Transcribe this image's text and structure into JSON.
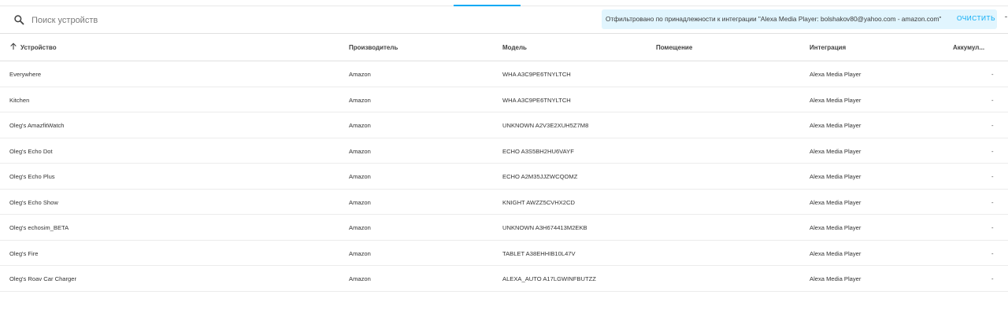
{
  "search": {
    "placeholder": "Поиск устройств"
  },
  "filter": {
    "text": "Отфильтровано по принадлежности к интеграции \"Alexa Media Player: bolshakov80@yahoo.com - amazon.com\"",
    "clear_label": "ОЧИСТИТЬ"
  },
  "columns": {
    "device": "Устройство",
    "manufacturer": "Производитель",
    "model": "Модель",
    "room": "Помещение",
    "integration": "Интеграция",
    "battery": "Аккумул..."
  },
  "rows": [
    {
      "device": "Everywhere",
      "manufacturer": "Amazon",
      "model": "WHA A3C9PE6TNYLTCH",
      "room": "",
      "integration": "Alexa Media Player",
      "battery": "-"
    },
    {
      "device": "Kitchen",
      "manufacturer": "Amazon",
      "model": "WHA A3C9PE6TNYLTCH",
      "room": "",
      "integration": "Alexa Media Player",
      "battery": "-"
    },
    {
      "device": "Oleg's AmazfitWatch",
      "manufacturer": "Amazon",
      "model": "UNKNOWN A2V3E2XUH5Z7M8",
      "room": "",
      "integration": "Alexa Media Player",
      "battery": "-"
    },
    {
      "device": "Oleg's Echo Dot",
      "manufacturer": "Amazon",
      "model": "ECHO A3S5BH2HU6VAYF",
      "room": "",
      "integration": "Alexa Media Player",
      "battery": "-"
    },
    {
      "device": "Oleg's Echo Plus",
      "manufacturer": "Amazon",
      "model": "ECHO A2M35JJZWCQOMZ",
      "room": "",
      "integration": "Alexa Media Player",
      "battery": "-"
    },
    {
      "device": "Oleg's Echo Show",
      "manufacturer": "Amazon",
      "model": "KNIGHT AWZZ5CVHX2CD",
      "room": "",
      "integration": "Alexa Media Player",
      "battery": "-"
    },
    {
      "device": "Oleg's echosim_BETA",
      "manufacturer": "Amazon",
      "model": "UNKNOWN A3H674413M2EKB",
      "room": "",
      "integration": "Alexa Media Player",
      "battery": "-"
    },
    {
      "device": "Oleg's Fire",
      "manufacturer": "Amazon",
      "model": "TABLET A38EHHIB10L47V",
      "room": "",
      "integration": "Alexa Media Player",
      "battery": "-"
    },
    {
      "device": "Oleg's Roav Car Charger",
      "manufacturer": "Amazon",
      "model": "ALEXA_AUTO A17LGWINFBUTZZ",
      "room": "",
      "integration": "Alexa Media Player",
      "battery": "-"
    }
  ],
  "colors": {
    "accent": "#03a9f4",
    "chip_background": "#e1f5fe"
  },
  "icons": {
    "search": "search-icon",
    "sort": "arrow-up-icon"
  }
}
